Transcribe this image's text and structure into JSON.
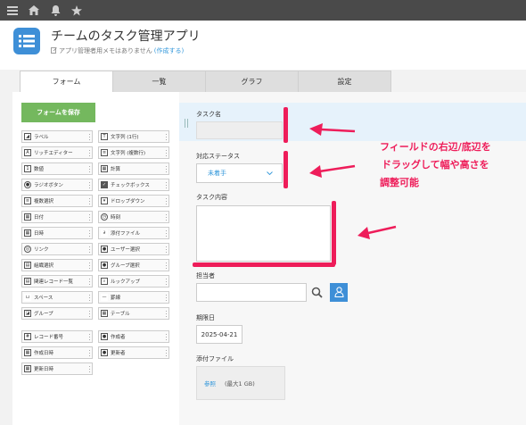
{
  "topbar": {
    "menu_icon": "hamburger-menu-icon",
    "home_icon": "home-icon",
    "bell_icon": "bell-icon",
    "star_icon": "star-icon"
  },
  "app": {
    "title": "チームのタスク管理アプリ",
    "memo": "アプリ管理者用メモはありません",
    "memo_link": "(作成する)"
  },
  "tabs": [
    "フォーム",
    "一覧",
    "グラフ",
    "設定"
  ],
  "save_button": "フォームを保存",
  "palette": {
    "col1": [
      "ラベル",
      "リッチエディター",
      "数値",
      "ラジオボタン",
      "複数選択",
      "日付",
      "日時",
      "リンク",
      "組織選択",
      "関連レコード一覧",
      "スペース",
      "グループ"
    ],
    "col2": [
      "文字列 (1行)",
      "文字列 (複数行)",
      "計算",
      "チェックボックス",
      "ドロップダウン",
      "時刻",
      "添付ファイル",
      "ユーザー選択",
      "グループ選択",
      "ルックアップ",
      "罫線",
      "テーブル"
    ],
    "sys_col1": [
      "レコード番号",
      "作成日時",
      "更新日時"
    ],
    "sys_col2": [
      "作成者",
      "更新者"
    ]
  },
  "fields": {
    "task_name_label": "タスク名",
    "status_label": "対応ステータス",
    "status_value": "未着手",
    "content_label": "タスク内容",
    "assignee_label": "担当者",
    "due_label": "期限日",
    "due_value": "2025-04-21",
    "attach_label": "添付ファイル",
    "attach_link": "参照",
    "attach_limit": "(最大1 GB)"
  },
  "annotation": [
    "フィールドの右辺/底辺を",
    "ドラッグして幅や高さを",
    "調整可能"
  ],
  "colors": {
    "accent_red": "#ee1d5a",
    "save_green": "#74b85e",
    "app_blue": "#3e8fd7",
    "link_blue": "#3498db"
  }
}
